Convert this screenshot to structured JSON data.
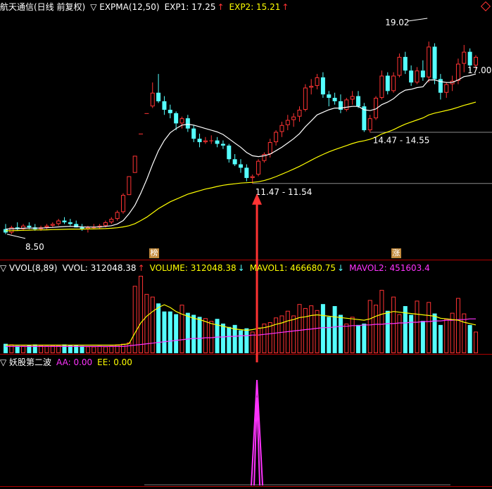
{
  "main_header": {
    "title": "航天通信(日线 前复权)",
    "indicator": "▽ EXPMA(12,50)",
    "exp1_label": "EXP1: 17.25",
    "exp1_arrow": "↑",
    "exp2_label": "EXP2: 15.21",
    "exp2_arrow": "↑"
  },
  "vol_header": {
    "indicator": "▽ VVOL(8,89)",
    "vvol_label": "VVOL: 312048.38",
    "vvol_arrow": "↑",
    "volume_label": "VOLUME: 312048.38",
    "volume_arrow": "↓",
    "mavol1_label": "MAVOL1: 466680.75",
    "mavol1_arrow": "↓",
    "mavol2_label": "MAVOL2: 451603.4"
  },
  "ind_header": {
    "indicator": "▽ 妖股第二波",
    "aa_label": "AA: 0.00",
    "ee_label": "EE: 0.00"
  },
  "markers": {
    "bang": "榜",
    "zhang": "涨"
  },
  "annotations": {
    "high": "19.02",
    "ema_level": "17.00",
    "low": "8.50",
    "support1": "14.47 - 14.55",
    "support2": "11.47 - 11.54"
  },
  "colors": {
    "up": "#ff3333",
    "down": "#55ffff",
    "exp1": "#ffffff",
    "exp2": "#ffff00",
    "mavol1": "#ffff00",
    "mavol2": "#ff33ff",
    "signal": "#ff33ff",
    "arrow": "#ff3333",
    "divider": "#b00000"
  },
  "chart_data": {
    "type": "candlestick",
    "price_ylim": [
      8,
      21
    ],
    "candles": [
      {
        "o": 8.8,
        "h": 9.1,
        "l": 8.5,
        "c": 8.6
      },
      {
        "o": 8.6,
        "h": 9.0,
        "l": 8.5,
        "c": 8.9
      },
      {
        "o": 8.9,
        "h": 9.2,
        "l": 8.7,
        "c": 8.8
      },
      {
        "o": 8.8,
        "h": 9.1,
        "l": 8.7,
        "c": 9.0
      },
      {
        "o": 9.0,
        "h": 9.2,
        "l": 8.8,
        "c": 8.9
      },
      {
        "o": 8.9,
        "h": 9.1,
        "l": 8.7,
        "c": 8.8
      },
      {
        "o": 8.8,
        "h": 9.0,
        "l": 8.7,
        "c": 8.9
      },
      {
        "o": 8.9,
        "h": 9.1,
        "l": 8.8,
        "c": 9.0
      },
      {
        "o": 9.0,
        "h": 9.2,
        "l": 8.9,
        "c": 9.1
      },
      {
        "o": 9.1,
        "h": 9.4,
        "l": 9.0,
        "c": 9.3
      },
      {
        "o": 9.3,
        "h": 9.5,
        "l": 9.1,
        "c": 9.2
      },
      {
        "o": 9.2,
        "h": 9.4,
        "l": 9.0,
        "c": 9.1
      },
      {
        "o": 9.1,
        "h": 9.3,
        "l": 8.9,
        "c": 8.9
      },
      {
        "o": 8.9,
        "h": 9.1,
        "l": 8.7,
        "c": 8.8
      },
      {
        "o": 8.8,
        "h": 9.0,
        "l": 8.6,
        "c": 8.9
      },
      {
        "o": 8.9,
        "h": 9.1,
        "l": 8.8,
        "c": 8.9
      },
      {
        "o": 8.9,
        "h": 9.1,
        "l": 8.8,
        "c": 9.0
      },
      {
        "o": 9.0,
        "h": 9.3,
        "l": 8.9,
        "c": 9.2
      },
      {
        "o": 9.2,
        "h": 9.5,
        "l": 9.1,
        "c": 9.4
      },
      {
        "o": 9.4,
        "h": 9.9,
        "l": 9.3,
        "c": 9.8
      },
      {
        "o": 9.8,
        "h": 10.9,
        "l": 9.7,
        "c": 10.8
      },
      {
        "o": 10.8,
        "h": 11.9,
        "l": 10.8,
        "c": 11.9
      },
      {
        "o": 12.1,
        "h": 13.1,
        "l": 12.1,
        "c": 13.1
      },
      {
        "o": 14.4,
        "h": 14.4,
        "l": 14.4,
        "c": 14.4
      },
      {
        "o": 15.6,
        "h": 15.6,
        "l": 15.6,
        "c": 15.6
      },
      {
        "o": 16.0,
        "h": 17.4,
        "l": 15.9,
        "c": 16.8
      },
      {
        "o": 16.8,
        "h": 17.9,
        "l": 16.2,
        "c": 16.3
      },
      {
        "o": 16.3,
        "h": 16.6,
        "l": 15.5,
        "c": 15.8
      },
      {
        "o": 15.8,
        "h": 16.1,
        "l": 15.3,
        "c": 15.6
      },
      {
        "o": 15.6,
        "h": 15.7,
        "l": 14.6,
        "c": 15.0
      },
      {
        "o": 15.0,
        "h": 15.4,
        "l": 14.7,
        "c": 15.3
      },
      {
        "o": 15.3,
        "h": 15.5,
        "l": 14.5,
        "c": 14.7
      },
      {
        "o": 14.7,
        "h": 14.9,
        "l": 13.9,
        "c": 14.1
      },
      {
        "o": 14.1,
        "h": 14.4,
        "l": 13.6,
        "c": 13.9
      },
      {
        "o": 13.9,
        "h": 14.2,
        "l": 13.8,
        "c": 14.0
      },
      {
        "o": 14.0,
        "h": 14.3,
        "l": 13.8,
        "c": 14.0
      },
      {
        "o": 14.0,
        "h": 14.2,
        "l": 13.6,
        "c": 13.8
      },
      {
        "o": 13.8,
        "h": 14.0,
        "l": 13.5,
        "c": 13.7
      },
      {
        "o": 13.7,
        "h": 13.8,
        "l": 12.7,
        "c": 12.9
      },
      {
        "o": 12.9,
        "h": 13.2,
        "l": 12.5,
        "c": 12.6
      },
      {
        "o": 12.6,
        "h": 12.9,
        "l": 12.1,
        "c": 12.4
      },
      {
        "o": 12.4,
        "h": 12.6,
        "l": 11.6,
        "c": 11.8
      },
      {
        "o": 11.8,
        "h": 12.0,
        "l": 11.47,
        "c": 11.9
      },
      {
        "o": 12.0,
        "h": 12.9,
        "l": 11.9,
        "c": 12.8
      },
      {
        "o": 12.8,
        "h": 13.3,
        "l": 12.7,
        "c": 13.2
      },
      {
        "o": 13.2,
        "h": 14.1,
        "l": 13.0,
        "c": 13.9
      },
      {
        "o": 13.9,
        "h": 14.6,
        "l": 13.7,
        "c": 14.5
      },
      {
        "o": 14.5,
        "h": 15.1,
        "l": 14.2,
        "c": 14.9
      },
      {
        "o": 14.9,
        "h": 15.5,
        "l": 14.6,
        "c": 15.2
      },
      {
        "o": 15.2,
        "h": 15.6,
        "l": 14.8,
        "c": 15.4
      },
      {
        "o": 15.4,
        "h": 16.0,
        "l": 15.1,
        "c": 15.8
      },
      {
        "o": 15.8,
        "h": 17.3,
        "l": 15.7,
        "c": 17.1
      },
      {
        "o": 17.1,
        "h": 17.6,
        "l": 16.7,
        "c": 17.2
      },
      {
        "o": 17.2,
        "h": 17.9,
        "l": 17.0,
        "c": 17.7
      },
      {
        "o": 17.7,
        "h": 18.0,
        "l": 16.5,
        "c": 16.7
      },
      {
        "o": 16.7,
        "h": 16.9,
        "l": 16.0,
        "c": 16.5
      },
      {
        "o": 16.5,
        "h": 16.8,
        "l": 16.1,
        "c": 16.3
      },
      {
        "o": 16.3,
        "h": 16.7,
        "l": 15.6,
        "c": 15.8
      },
      {
        "o": 15.8,
        "h": 16.5,
        "l": 15.7,
        "c": 16.4
      },
      {
        "o": 16.4,
        "h": 16.9,
        "l": 16.1,
        "c": 16.6
      },
      {
        "o": 16.6,
        "h": 16.9,
        "l": 15.9,
        "c": 16.0
      },
      {
        "o": 16.0,
        "h": 16.2,
        "l": 14.5,
        "c": 14.6
      },
      {
        "o": 14.6,
        "h": 15.5,
        "l": 14.47,
        "c": 15.3
      },
      {
        "o": 15.3,
        "h": 16.6,
        "l": 15.2,
        "c": 16.5
      },
      {
        "o": 16.5,
        "h": 18.1,
        "l": 16.4,
        "c": 17.8
      },
      {
        "o": 17.8,
        "h": 18.0,
        "l": 16.7,
        "c": 16.9
      },
      {
        "o": 16.9,
        "h": 18.0,
        "l": 16.8,
        "c": 17.8
      },
      {
        "o": 17.8,
        "h": 19.1,
        "l": 17.7,
        "c": 18.9
      },
      {
        "o": 18.9,
        "h": 19.2,
        "l": 17.9,
        "c": 18.1
      },
      {
        "o": 18.1,
        "h": 18.4,
        "l": 17.2,
        "c": 17.4
      },
      {
        "o": 17.4,
        "h": 18.3,
        "l": 17.3,
        "c": 18.1
      },
      {
        "o": 18.1,
        "h": 18.7,
        "l": 17.5,
        "c": 17.7
      },
      {
        "o": 17.7,
        "h": 19.8,
        "l": 17.4,
        "c": 19.5
      },
      {
        "o": 19.5,
        "h": 19.7,
        "l": 17.3,
        "c": 17.6
      },
      {
        "o": 17.6,
        "h": 17.9,
        "l": 16.4,
        "c": 16.8
      },
      {
        "o": 16.8,
        "h": 17.4,
        "l": 16.5,
        "c": 17.3
      },
      {
        "o": 17.3,
        "h": 17.8,
        "l": 16.9,
        "c": 17.5
      },
      {
        "o": 17.5,
        "h": 18.8,
        "l": 17.3,
        "c": 18.5
      },
      {
        "o": 18.5,
        "h": 19.6,
        "l": 18.0,
        "c": 19.2
      },
      {
        "o": 19.2,
        "h": 19.4,
        "l": 18.1,
        "c": 18.4
      },
      {
        "o": 18.4,
        "h": 19.0,
        "l": 18.2,
        "c": 18.9
      }
    ],
    "exp1": [
      8.8,
      8.82,
      8.83,
      8.85,
      8.86,
      8.86,
      8.86,
      8.88,
      8.9,
      8.93,
      8.95,
      8.96,
      8.95,
      8.93,
      8.92,
      8.92,
      8.93,
      8.96,
      9.0,
      9.1,
      9.3,
      9.7,
      10.2,
      10.9,
      11.7,
      12.6,
      13.4,
      14.0,
      14.45,
      14.7,
      14.9,
      14.95,
      14.9,
      14.8,
      14.7,
      14.6,
      14.5,
      14.35,
      14.1,
      13.85,
      13.6,
      13.3,
      13.1,
      13.05,
      13.1,
      13.2,
      13.4,
      13.6,
      13.85,
      14.1,
      14.4,
      14.8,
      15.15,
      15.5,
      15.65,
      15.8,
      15.9,
      15.9,
      15.95,
      16.0,
      16.0,
      15.8,
      15.75,
      15.85,
      16.1,
      16.25,
      16.45,
      16.75,
      16.95,
      17.0,
      17.1,
      17.15,
      17.55,
      17.55,
      17.45,
      17.4,
      17.4,
      17.55,
      17.75,
      17.8,
      17.9
    ],
    "exp2": [
      8.7,
      8.71,
      8.72,
      8.73,
      8.74,
      8.75,
      8.75,
      8.76,
      8.77,
      8.78,
      8.79,
      8.8,
      8.8,
      8.8,
      8.81,
      8.81,
      8.82,
      8.83,
      8.85,
      8.88,
      8.93,
      9.0,
      9.12,
      9.3,
      9.5,
      9.75,
      10.0,
      10.2,
      10.4,
      10.55,
      10.7,
      10.85,
      10.95,
      11.05,
      11.15,
      11.22,
      11.3,
      11.37,
      11.42,
      11.46,
      11.5,
      11.52,
      11.54,
      11.58,
      11.65,
      11.75,
      11.88,
      12.02,
      12.17,
      12.32,
      12.48,
      12.66,
      12.84,
      13.02,
      13.18,
      13.33,
      13.46,
      13.58,
      13.7,
      13.82,
      13.92,
      13.98,
      14.07,
      14.2,
      14.38,
      14.5,
      14.63,
      14.8,
      14.96,
      15.08,
      15.2,
      15.32,
      15.5,
      15.6,
      15.68,
      15.76,
      15.84,
      15.95,
      16.06,
      16.15,
      16.25
    ],
    "volumes": [
      14,
      13,
      11,
      11,
      12,
      13,
      12,
      11,
      12,
      12,
      13,
      12,
      12,
      11,
      10,
      10,
      11,
      10,
      11,
      13,
      14,
      16,
      100,
      115,
      88,
      84,
      74,
      62,
      62,
      58,
      72,
      60,
      57,
      54,
      52,
      48,
      51,
      44,
      39,
      42,
      34,
      37,
      32,
      38,
      44,
      46,
      53,
      56,
      63,
      56,
      73,
      67,
      71,
      64,
      73,
      54,
      70,
      57,
      44,
      54,
      42,
      44,
      79,
      72,
      94,
      63,
      84,
      58,
      70,
      57,
      78,
      48,
      76,
      59,
      42,
      51,
      60,
      82,
      59,
      42,
      32
    ],
    "mavol1": [
      12,
      12,
      12,
      12,
      12,
      12,
      12,
      12,
      12,
      12,
      12,
      12,
      12,
      12,
      12,
      12,
      12,
      12,
      12,
      12,
      13,
      14,
      30,
      45,
      55,
      62,
      68,
      72,
      68,
      62,
      58,
      55,
      52,
      50,
      47,
      44,
      42,
      40,
      38,
      36,
      35,
      34,
      35,
      37,
      38,
      40,
      43,
      45,
      48,
      50,
      53,
      54,
      56,
      57,
      56,
      55,
      54,
      53,
      52,
      51,
      50,
      49,
      51,
      55,
      58,
      60,
      62,
      61,
      60,
      59,
      58,
      57,
      56,
      55,
      52,
      51,
      50,
      49,
      46,
      44,
      42
    ],
    "mavol2": [
      10,
      10,
      10,
      10,
      10,
      10,
      10,
      10,
      10,
      10,
      10,
      10,
      10,
      10,
      10,
      10,
      10,
      10,
      10,
      10,
      10,
      11,
      12,
      13,
      14,
      15,
      16,
      17,
      18,
      19,
      20,
      21,
      22,
      22,
      23,
      23,
      24,
      24,
      25,
      25,
      26,
      26,
      27,
      27,
      28,
      29,
      30,
      31,
      32,
      33,
      34,
      35,
      36,
      37,
      38,
      38,
      39,
      40,
      40,
      41,
      41,
      42,
      42,
      43,
      43,
      44,
      44,
      45,
      45,
      46,
      46,
      47,
      47,
      48,
      48,
      49,
      49,
      50,
      50,
      51,
      51
    ],
    "aa_signal": [
      0,
      0,
      0,
      0,
      0,
      0,
      0,
      0,
      0,
      0,
      0,
      0,
      0,
      0,
      0,
      0,
      0,
      0,
      0,
      0,
      0,
      0,
      0,
      0,
      0,
      0,
      0,
      0,
      0,
      0,
      0,
      0,
      0,
      0,
      0,
      0,
      0,
      0,
      0,
      0,
      0,
      0,
      0,
      1,
      0,
      0,
      0,
      0,
      0,
      0,
      0,
      0,
      0,
      0,
      0,
      0,
      0,
      0,
      0,
      0,
      0,
      0,
      0,
      0,
      0,
      0,
      0,
      0,
      0,
      0,
      0,
      0,
      0,
      0,
      0,
      0,
      0,
      0,
      0,
      0,
      0
    ]
  }
}
